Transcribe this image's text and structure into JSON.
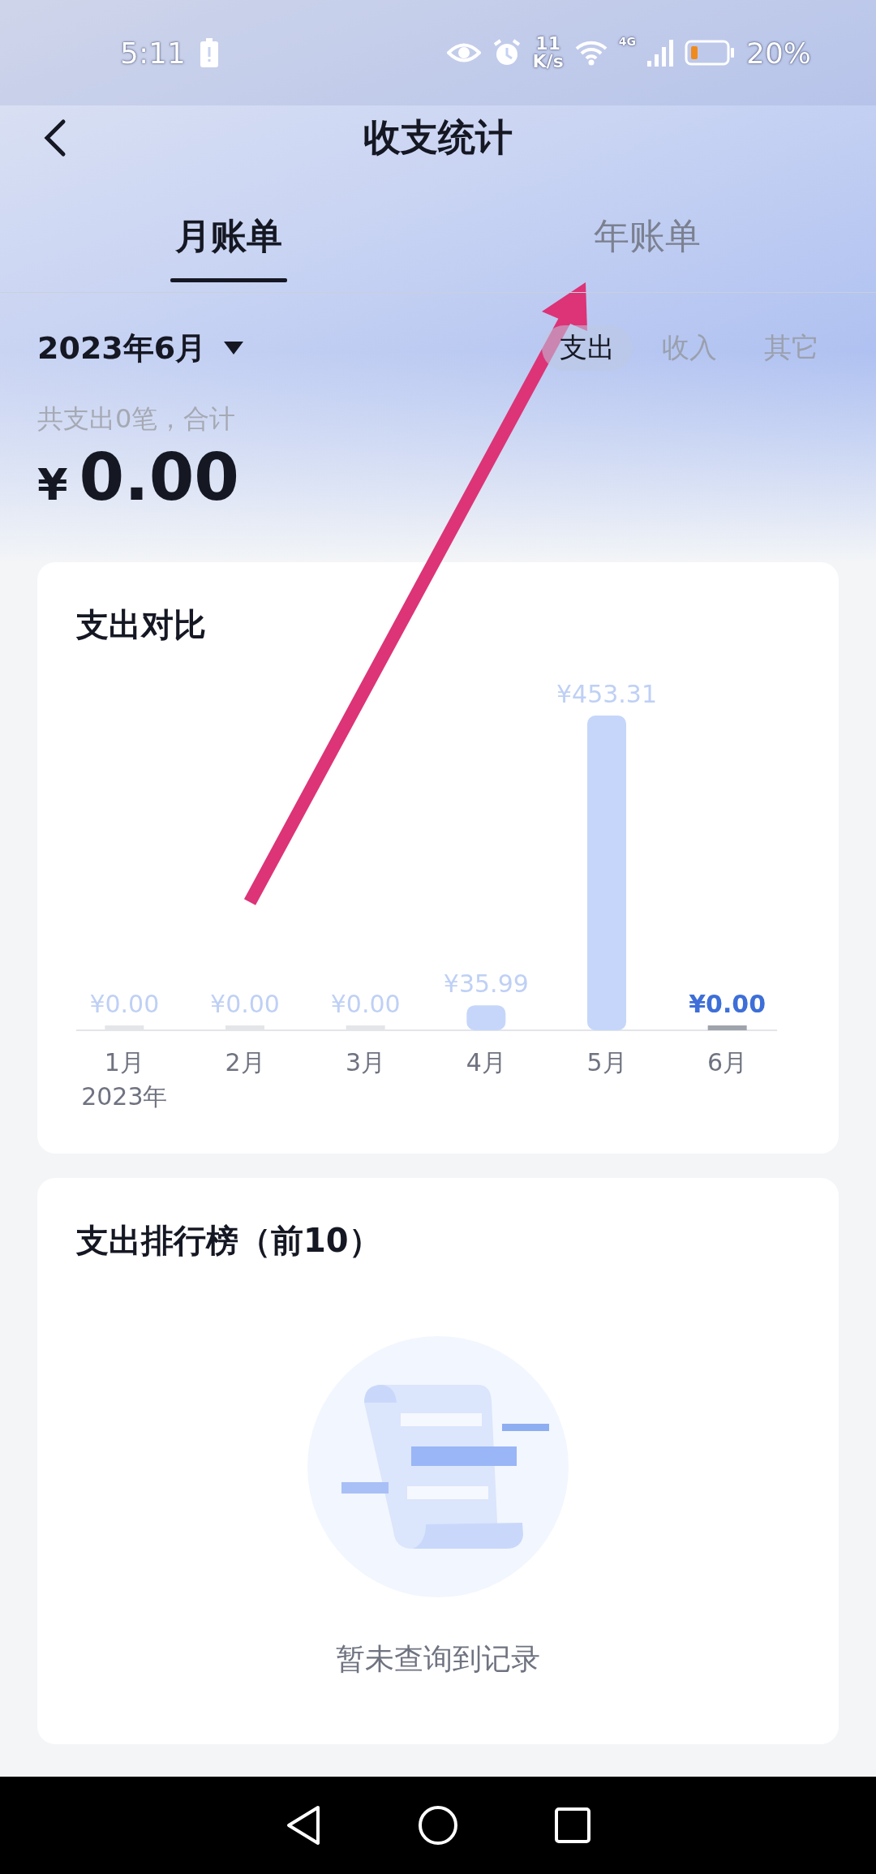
{
  "status_bar": {
    "time": "5:11",
    "speed_value": "11",
    "speed_unit": "K/s",
    "network": "4G",
    "battery": "20%"
  },
  "header": {
    "title": "收支统计"
  },
  "tabs": [
    {
      "label": "月账单",
      "selected": true
    },
    {
      "label": "年账单",
      "selected": false
    }
  ],
  "period": {
    "label": "2023年6月"
  },
  "types": [
    {
      "label": "支出",
      "selected": true
    },
    {
      "label": "收入",
      "selected": false
    },
    {
      "label": "其它",
      "selected": false
    }
  ],
  "summary": {
    "caption": "共支出0笔，合计",
    "currency": "¥",
    "amount": "0.00"
  },
  "comparison_card": {
    "title": "支出对比",
    "year_label": "2023年",
    "chart_data": {
      "type": "bar",
      "categories": [
        "1月",
        "2月",
        "3月",
        "4月",
        "5月",
        "6月"
      ],
      "values": [
        0,
        0,
        0,
        35.99,
        453.31,
        0
      ],
      "value_labels": [
        "¥0.00",
        "¥0.00",
        "¥0.00",
        "¥35.99",
        "¥453.31",
        "¥0.00"
      ]
    },
    "highlighted": [
      false,
      false,
      false,
      false,
      false,
      true
    ]
  },
  "ranking_card": {
    "title": "支出排行榜（前10）",
    "empty_text": "暂未查询到记录"
  },
  "annotation": {
    "kind": "arrow"
  }
}
